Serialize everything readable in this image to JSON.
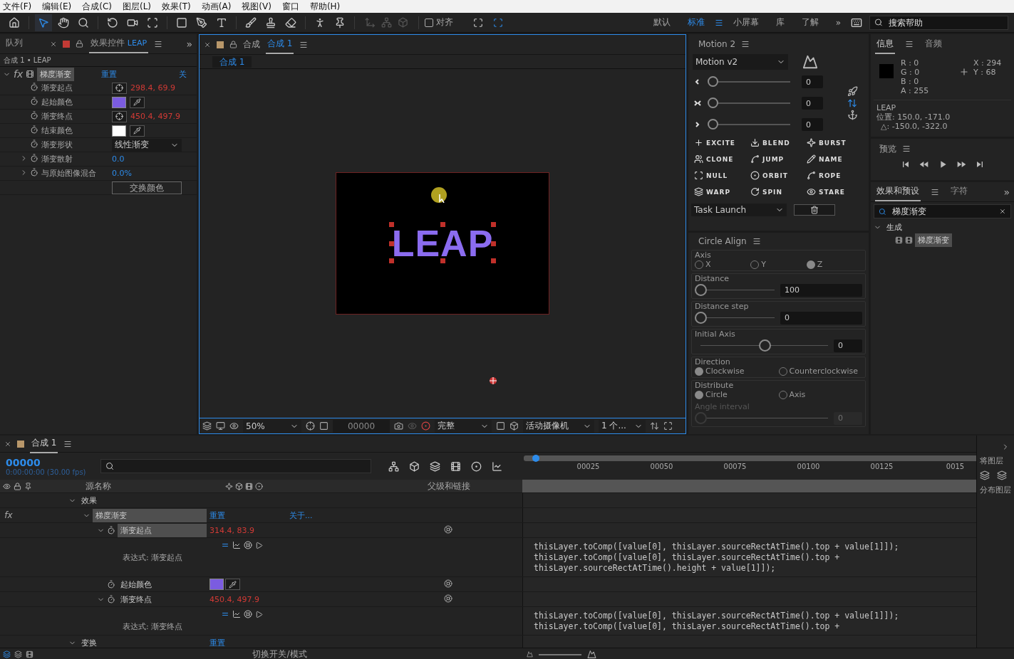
{
  "menu": [
    "文件(F)",
    "编辑(E)",
    "合成(C)",
    "图层(L)",
    "效果(T)",
    "动画(A)",
    "视图(V)",
    "窗口",
    "帮助(H)"
  ],
  "toolbar": {
    "tools": [
      {
        "kind": "home",
        "selected": false
      },
      {
        "kind": "select",
        "selected": true
      },
      {
        "kind": "hand",
        "selected": false
      },
      {
        "kind": "zoom",
        "selected": false
      },
      {
        "kind": "rotate",
        "selected": false
      },
      {
        "kind": "camera",
        "selected": false
      },
      {
        "kind": "pan",
        "selected": false
      },
      {
        "kind": "rect",
        "selected": false
      },
      {
        "kind": "pen",
        "selected": false
      },
      {
        "kind": "text",
        "selected": false
      },
      {
        "kind": "brush",
        "selected": false
      },
      {
        "kind": "stamp",
        "selected": false
      },
      {
        "kind": "eraser",
        "selected": false
      },
      {
        "kind": "roto",
        "selected": false
      },
      {
        "kind": "pin",
        "selected": false
      }
    ],
    "snap": {
      "label": "对齐",
      "checked": false
    },
    "workspaces": [
      {
        "label": "默认",
        "selected": false
      },
      {
        "label": "标准",
        "selected": true
      },
      {
        "label": "小屏幕",
        "selected": false
      },
      {
        "label": "库",
        "selected": false
      },
      {
        "label": "了解",
        "selected": false
      }
    ],
    "more": "»",
    "search_placeholder": "搜索帮助"
  },
  "effect_controls": {
    "prev_tab": "队列",
    "title": "效果控件",
    "layer": "LEAP",
    "more": "»",
    "breadcrumb": "合成 1 • LEAP",
    "effect": {
      "badge": "fx",
      "name": "梯度渐变",
      "reset": "重置",
      "about": "关"
    },
    "properties": [
      {
        "kind": "point",
        "name": "渐变起点",
        "value": "298.4, 69.9"
      },
      {
        "kind": "color",
        "name": "起始颜色",
        "color": "#7b5ce0"
      },
      {
        "kind": "point",
        "name": "渐变终点",
        "value": "450.4, 497.9"
      },
      {
        "kind": "color",
        "name": "结束颜色",
        "color": "#ffffff"
      },
      {
        "kind": "dropdown",
        "name": "渐变形状",
        "value": "线性渐变"
      },
      {
        "kind": "number",
        "name": "渐变散射",
        "value": "0.0"
      },
      {
        "kind": "number",
        "name": "与原始图像混合",
        "value": "0.0%"
      },
      {
        "kind": "button",
        "value": "交换颜色"
      }
    ]
  },
  "composition": {
    "title": "合成",
    "name": "合成 1",
    "crumb": "合成 1",
    "canvas_text": "LEAP",
    "zoom": "50%",
    "timecode": "00000",
    "quality": "完整",
    "camera": "活动摄像机",
    "views": "1 个..."
  },
  "motion": {
    "title": "Motion 2",
    "preset": "Motion v2",
    "sliders": [
      {
        "kind": "left",
        "level": 0,
        "value": "0"
      },
      {
        "kind": "both",
        "level": 0,
        "value": "0"
      },
      {
        "kind": "right",
        "level": 0,
        "value": "0"
      }
    ],
    "buttons": [
      {
        "kind": "plus",
        "label": "EXCITE"
      },
      {
        "kind": "blend",
        "label": "BLEND"
      },
      {
        "kind": "burst",
        "label": "BURST"
      },
      {
        "kind": "clone",
        "label": "CLONE"
      },
      {
        "kind": "jump",
        "label": "JUMP"
      },
      {
        "kind": "name",
        "label": "NAME"
      },
      {
        "kind": "null",
        "label": "NULL"
      },
      {
        "kind": "orbit",
        "label": "ORBIT"
      },
      {
        "kind": "rope",
        "label": "ROPE"
      },
      {
        "kind": "warp",
        "label": "WARP"
      },
      {
        "kind": "spin",
        "label": "SPIN"
      },
      {
        "kind": "stare",
        "label": "STARE"
      }
    ],
    "task": "Task Launch"
  },
  "circle_align": {
    "title": "Circle Align",
    "axis": {
      "label": "Axis",
      "options": [
        {
          "label": "X",
          "selected": false
        },
        {
          "label": "Y",
          "selected": false
        },
        {
          "label": "Z",
          "selected": true
        }
      ]
    },
    "distance": {
      "label": "Distance",
      "level": 0,
      "value": "100"
    },
    "distance_step": {
      "label": "Distance step",
      "level": 0,
      "value": "0"
    },
    "initial_axis": {
      "label": "Initial Axis",
      "level": 0.5,
      "value": "0"
    },
    "direction": {
      "label": "Direction",
      "options": [
        {
          "label": "Clockwise",
          "selected": true
        },
        {
          "label": "Counterclockwise",
          "selected": false
        }
      ]
    },
    "distribute": {
      "label": "Distribute",
      "options": [
        {
          "label": "Circle",
          "selected": true
        },
        {
          "label": "Axis",
          "selected": false
        }
      ]
    },
    "angle_interval": {
      "label": "Angle interval",
      "level": 0,
      "value": "0",
      "disabled": true
    }
  },
  "info": {
    "tabs": [
      {
        "label": "信息",
        "selected": true
      },
      {
        "label": "音频",
        "selected": false
      }
    ],
    "channels": [
      {
        "label": "R :",
        "value": "0"
      },
      {
        "label": "G :",
        "value": "0"
      },
      {
        "label": "B :",
        "value": "0"
      },
      {
        "label": "A :",
        "value": "255"
      }
    ],
    "coords": [
      {
        "label": "X :",
        "value": "294"
      },
      {
        "label": "Y :",
        "value": "68"
      }
    ],
    "layer": "LEAP",
    "position": "位置: 150.0, -171.0",
    "delta": "△: -150.0, -322.0"
  },
  "preview": {
    "title": "预览"
  },
  "effects_presets": {
    "tabs": [
      {
        "label": "效果和预设",
        "selected": true
      },
      {
        "label": "字符",
        "selected": false
      }
    ],
    "more": "»",
    "search": "梯度渐变",
    "tree": [
      {
        "label": "生成",
        "expanded": true,
        "children": [
          {
            "label": "梯度渐变",
            "selected": true
          }
        ]
      }
    ]
  },
  "timeline": {
    "tab": "合成 1",
    "timecode": "00000",
    "fps": "0:00:00:00 (30.00 fps)",
    "source_column": "源名称",
    "parent_column": "父级和链接",
    "ticks": [
      "00025",
      "00050",
      "00075",
      "00100",
      "00125",
      "0015"
    ],
    "tree": [
      {
        "kind": "group",
        "label": "效果",
        "expanded": true,
        "children": [
          {
            "kind": "effect",
            "badge": "fx",
            "label": "梯度渐变",
            "expanded": true,
            "selected": true,
            "reset": "重置",
            "about": "关于...",
            "children": [
              {
                "kind": "property",
                "label": "渐变起点",
                "expanded": true,
                "selected": true,
                "value": "314.4, 83.9",
                "expression": {
                  "label": "表达式: 渐变起点",
                  "code": [
                    "thisLayer.toComp([value[0], thisLayer.sourceRectAtTime().top + value[1]]);",
                    "thisLayer.toComp([value[0], thisLayer.sourceRectAtTime().top +",
                    "thisLayer.sourceRectAtTime().height + value[1]]);"
                  ]
                }
              },
              {
                "kind": "color",
                "label": "起始颜色",
                "selected": false,
                "color": "#7b5ce0"
              },
              {
                "kind": "property",
                "label": "渐变终点",
                "expanded": true,
                "selected": false,
                "value": "450.4, 497.9",
                "expression": {
                  "label": "表达式: 渐变终点",
                  "code": [
                    "thisLayer.toComp([value[0], thisLayer.sourceRectAtTime().top + value[1]]);",
                    "thisLayer.toComp([value[0], thisLayer.sourceRectAtTime().top +"
                  ]
                }
              }
            ]
          }
        ]
      },
      {
        "kind": "group",
        "label": "变换",
        "expanded": true,
        "reset": "重置"
      }
    ]
  },
  "side_panel": {
    "labels": [
      "将图层",
      "分布图层"
    ]
  },
  "status_bar": {
    "label": "切换开关/模式"
  }
}
